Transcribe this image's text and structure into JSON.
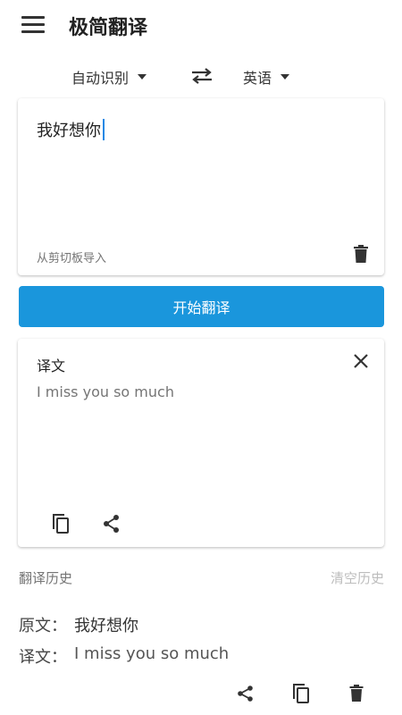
{
  "app": {
    "title": "极简翻译",
    "icons": {
      "menu": "menu-icon",
      "swap": "swap-icon",
      "delete": "trash-icon",
      "close": "close-icon",
      "copy": "copy-icon",
      "share": "share-icon"
    }
  },
  "languages": {
    "source": "自动识别",
    "target": "英语"
  },
  "input": {
    "text": "我好想你",
    "clipboard_label": "从剪切板导入"
  },
  "translate_button": "开始翻译",
  "output": {
    "title": "译文",
    "text": "I miss you so much"
  },
  "history": {
    "title": "翻译历史",
    "clear_label": "清空历史",
    "items": [
      {
        "source_label": "原文：",
        "source": "我好想你",
        "target_label": "译文：",
        "target": "I miss you so much"
      }
    ]
  },
  "colors": {
    "accent": "#1a96dc",
    "cursor": "#1e88e5",
    "text_primary": "#222222",
    "text_secondary": "#757575",
    "text_disabled": "#bdbdbd"
  }
}
